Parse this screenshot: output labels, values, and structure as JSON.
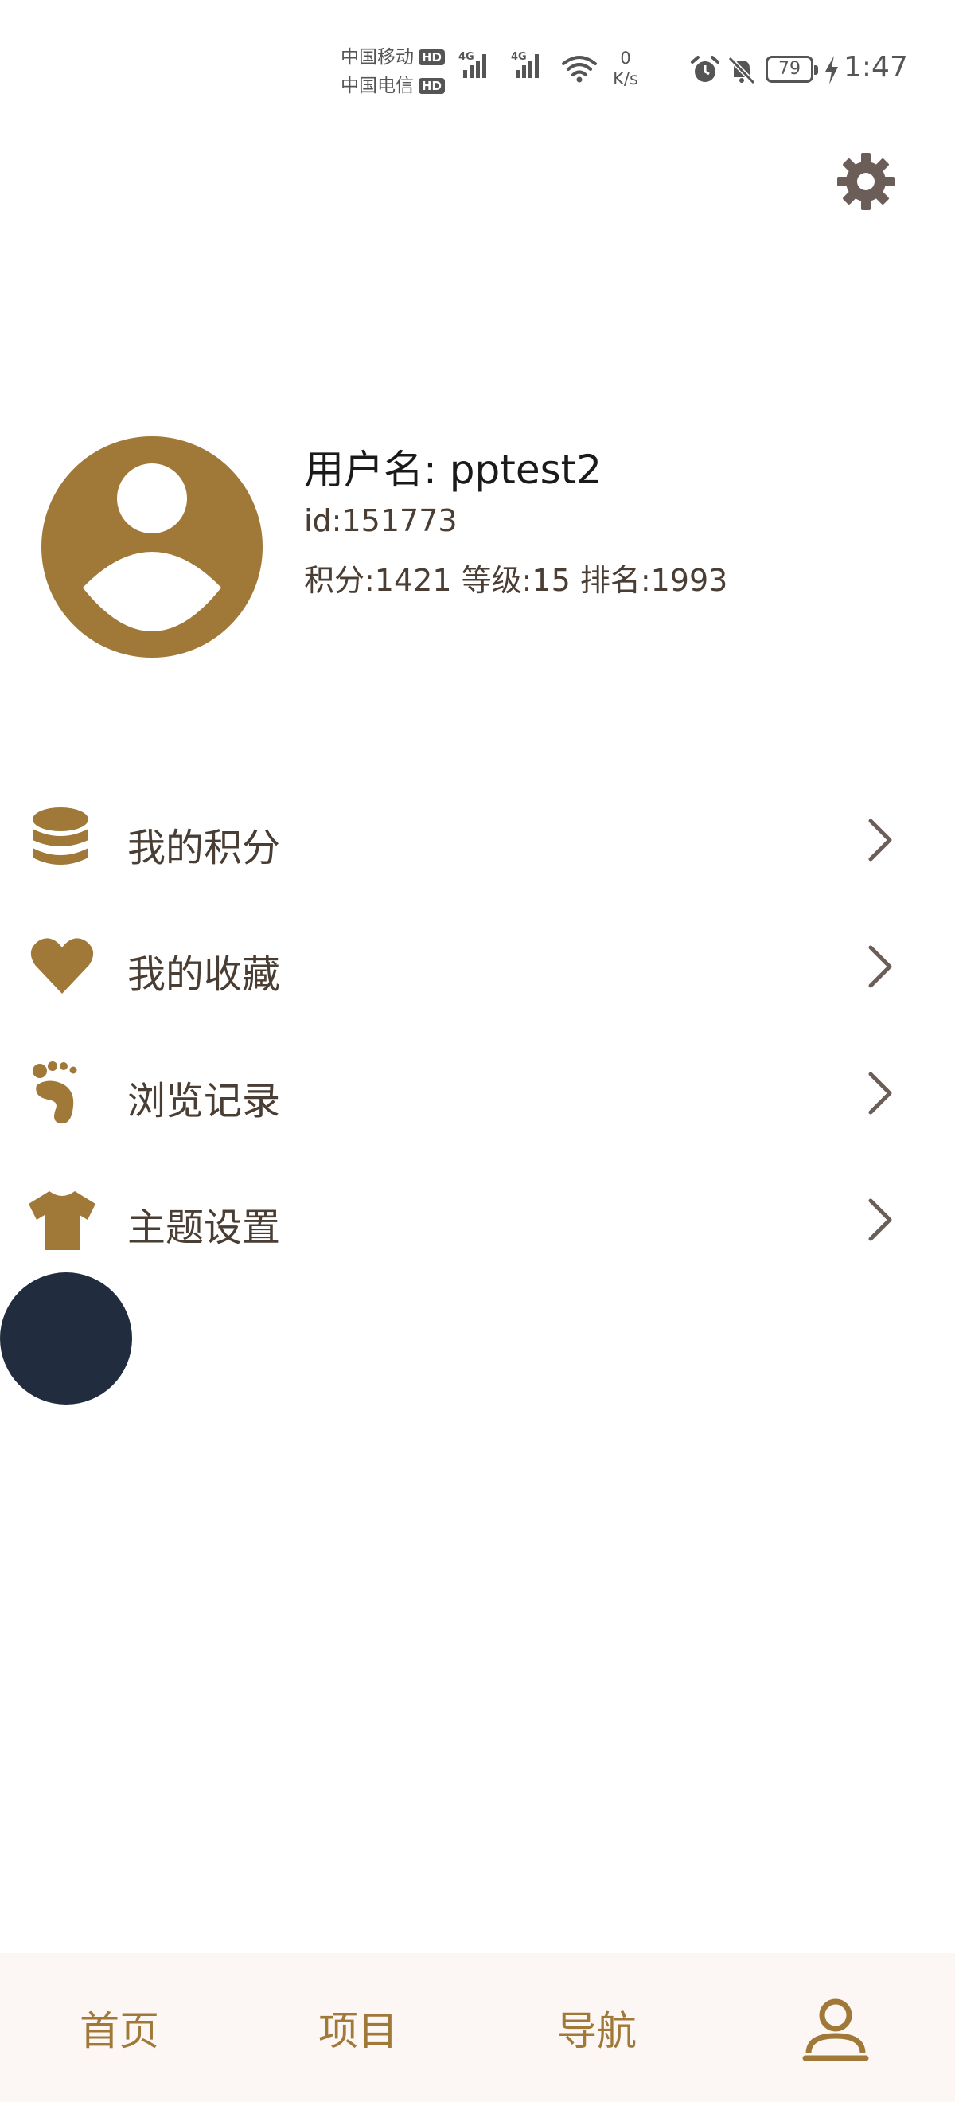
{
  "status_bar": {
    "carrier_1": "中国移动",
    "carrier_2": "中国电信",
    "hd_label": "HD",
    "network_tag": "4G",
    "speed_value": "0",
    "speed_unit": "K/s",
    "battery": "79",
    "time": "1:47"
  },
  "header": {
    "settings_icon": "gear-icon"
  },
  "profile": {
    "avatar_icon": "user-avatar-icon",
    "username": "用户名: pptest2",
    "user_id": "id:151773",
    "stats": "积分:1421 等级:15 排名:1993"
  },
  "menu": {
    "items": [
      {
        "label": "我的积分",
        "icon": "coins-icon"
      },
      {
        "label": "我的收藏",
        "icon": "heart-icon"
      },
      {
        "label": "浏览记录",
        "icon": "footprint-icon"
      },
      {
        "label": "主题设置",
        "icon": "tshirt-icon"
      }
    ]
  },
  "bottom_nav": {
    "home": "首页",
    "project": "项目",
    "guide": "导航",
    "mine_icon": "person-icon"
  },
  "colors": {
    "accent": "#a07838",
    "text": "#4a3d33",
    "fab": "#212d3e",
    "nav_bg": "#fcf7f4"
  }
}
